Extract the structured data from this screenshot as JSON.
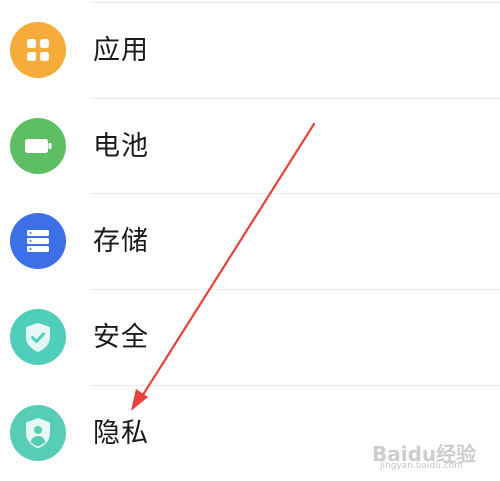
{
  "settings": {
    "items": [
      {
        "label": "应用",
        "icon": "apps-grid-icon",
        "color": "#f5ac3b"
      },
      {
        "label": "电池",
        "icon": "battery-icon",
        "color": "#5dbe63"
      },
      {
        "label": "存储",
        "icon": "storage-icon",
        "color": "#3d6fe6"
      },
      {
        "label": "安全",
        "icon": "security-shield-check-icon",
        "color": "#4fcfb9"
      },
      {
        "label": "隐私",
        "icon": "privacy-shield-user-icon",
        "color": "#58cdb6"
      }
    ]
  },
  "annotation": {
    "arrow_color": "#e8403a"
  },
  "watermark": {
    "logo_text": "Baidu经验",
    "url": "jingyan.baidu.com"
  }
}
